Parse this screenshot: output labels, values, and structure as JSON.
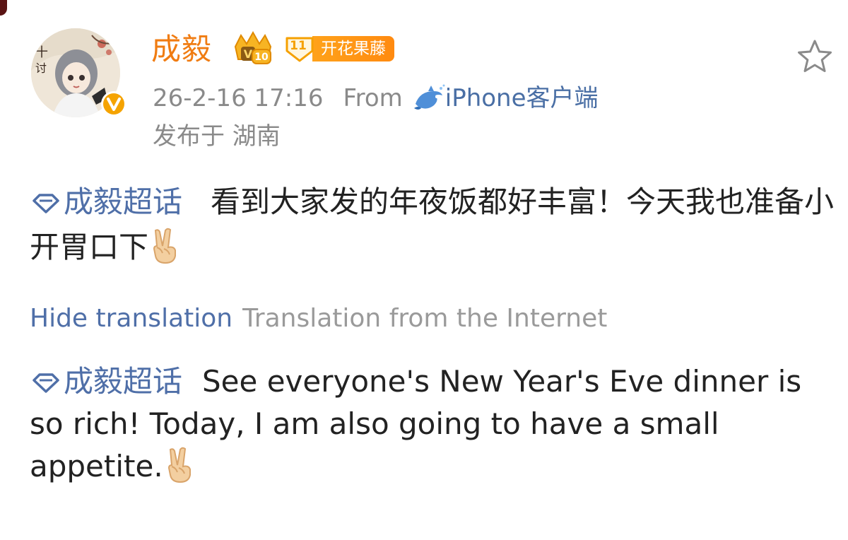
{
  "user": {
    "name": "成毅",
    "crown_badge_level": "10",
    "fan_badge_level": "11",
    "fan_badge_label": "开花果藤"
  },
  "post_meta": {
    "date": "26-2-16 17:16",
    "from_label": "From",
    "client": "iPhone客户端",
    "location": "发布于 湖南"
  },
  "post": {
    "topic": "成毅超话",
    "text": "看到大家发的年夜饭都好丰富！今天我也准备小开胃口下"
  },
  "translation": {
    "hide_label": "Hide translation",
    "source_label": "Translation from the Internet",
    "topic": "成毅超话",
    "text": "See everyone's New Year's Eve dinner is so rich! Today, I am also going to have a small appetite."
  },
  "icons": {
    "favorite": "star-outline-icon",
    "verified": "verified-v-icon",
    "topic": "diamond-topic-icon",
    "client": "dolphin-icon",
    "emoji": "victory-hand-emoji"
  },
  "colors": {
    "username": "#f07c12",
    "link": "#4f6fa8",
    "meta": "#8a8a8a",
    "badge": "#ff9a14"
  }
}
